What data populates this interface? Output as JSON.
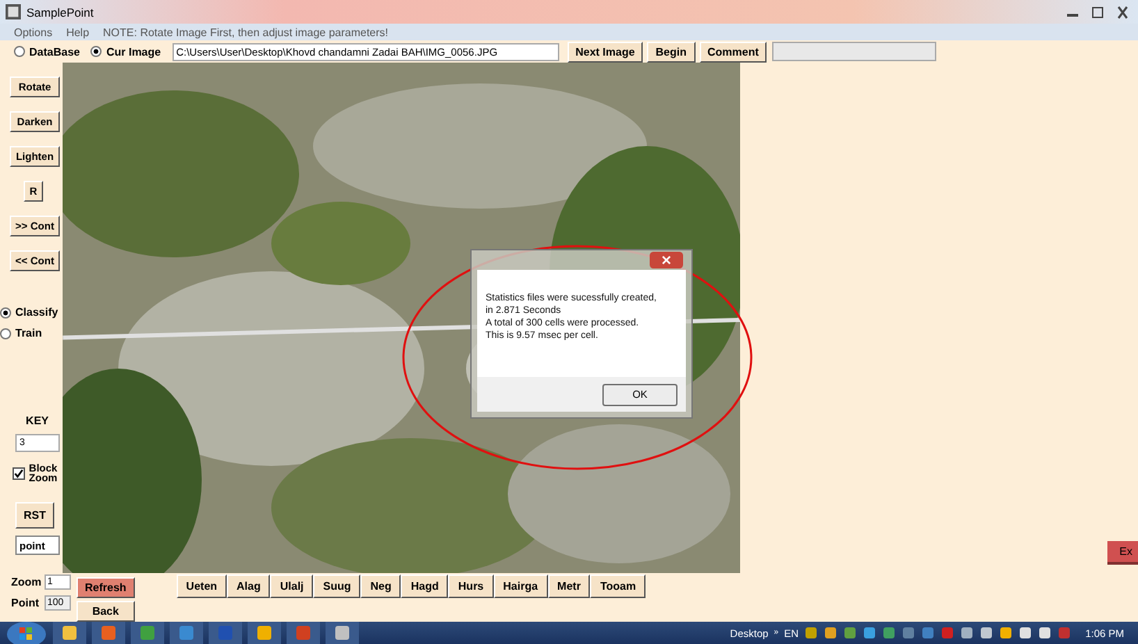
{
  "window": {
    "title": "SamplePoint"
  },
  "menu": [
    {
      "label": "Options"
    },
    {
      "label": "Help"
    }
  ],
  "note": "NOTE:  Rotate Image First, then adjust image parameters!",
  "source": [
    {
      "label": "DataBase",
      "selected": false
    },
    {
      "label": "Cur Image",
      "selected": true
    }
  ],
  "path": "C:\\Users\\User\\Desktop\\Khovd chandamni Zadai BAH\\IMG_0056.JPG",
  "toolbar_buttons": [
    "Next Image",
    "Begin",
    "Comment"
  ],
  "side_buttons": [
    "Rotate",
    "Darken",
    "Lighten",
    "R",
    ">> Cont",
    "<< Cont"
  ],
  "mode": [
    {
      "label": "Classify",
      "selected": true
    },
    {
      "label": "Train",
      "selected": false
    }
  ],
  "key": {
    "label": "KEY",
    "value": "3"
  },
  "block_zoom": {
    "label": "Block Zoom",
    "checked": true
  },
  "rst": "RST",
  "point_field": "point",
  "zoom": {
    "label": "Zoom",
    "value": "1"
  },
  "point": {
    "label": "Point",
    "value": "100"
  },
  "refresh": "Refresh",
  "back": "Back",
  "categories": [
    "Ueten",
    "Alag",
    "Ulalj",
    "Suug",
    "Neg",
    "Hagd",
    "Hurs",
    "Hairga",
    "Metr",
    "Tooam"
  ],
  "exit": "Ex",
  "dialog": {
    "lines": [
      "Statistics files were sucessfully created,",
      "in 2.871 Seconds",
      "A total of 300 cells were processed.",
      "This is 9.57 msec per cell."
    ],
    "button": "OK"
  },
  "taskbar": {
    "desktop": "Desktop",
    "chevron": "»",
    "language": "EN",
    "clock": "1:06 PM"
  }
}
